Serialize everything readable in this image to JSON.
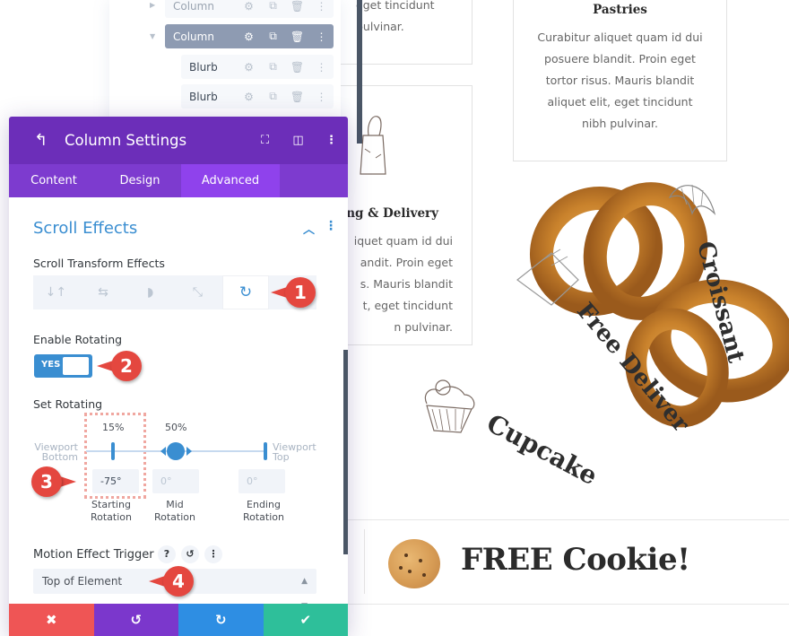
{
  "layers": {
    "rows": [
      {
        "label": "Column",
        "expanded": false,
        "selected": false
      },
      {
        "label": "Column",
        "expanded": true,
        "selected": true
      },
      {
        "label": "Blurb",
        "selected": false
      },
      {
        "label": "Blurb",
        "selected": false
      }
    ],
    "row_icons": [
      "gear-icon",
      "duplicate-icon",
      "trash-icon",
      "more-icon"
    ]
  },
  "page": {
    "card_left_top": {
      "lines": [
        "eget tincidunt",
        "pulvinar."
      ]
    },
    "card_left_mid": {
      "title": "ng & Delivery",
      "lines": [
        "iquet quam id dui",
        "andit. Proin eget",
        "s. Mauris blandit",
        "t, eget tincidunt",
        "n pulvinar."
      ]
    },
    "card_right_top": {
      "title": "Pastries",
      "lines": [
        "Curabitur aliquet quam id dui",
        "posuere blandit. Proin eget",
        "tortor risus. Mauris blandit",
        "aliquet elit, eget tincidunt",
        "nibh pulvinar."
      ]
    },
    "rotated_labels": {
      "croissant": "Croissant",
      "free_delivery": "Free Deliver",
      "cupcake": "Cupcake"
    },
    "promo": {
      "text": "FREE Cookie!"
    }
  },
  "modal": {
    "title": "Column Settings",
    "header_icons": [
      "back-icon",
      "fullscreen-icon",
      "split-view-icon",
      "more-icon"
    ],
    "tabs": [
      {
        "label": "Content",
        "active": false
      },
      {
        "label": "Design",
        "active": false
      },
      {
        "label": "Advanced",
        "active": true
      }
    ],
    "section": {
      "title": "Scroll Effects",
      "expanded": true
    },
    "scroll_transform": {
      "label": "Scroll Transform Effects",
      "effects": [
        {
          "name": "vertical-motion",
          "glyph": "↓↑",
          "active": false
        },
        {
          "name": "horizontal-motion",
          "glyph": "⇆",
          "active": false
        },
        {
          "name": "fading",
          "glyph": "◗",
          "active": false
        },
        {
          "name": "scaling",
          "glyph": "⤡",
          "active": false
        },
        {
          "name": "rotating",
          "glyph": "↻",
          "active": true
        }
      ]
    },
    "enable_rotating": {
      "label": "Enable Rotating",
      "value": "YES",
      "on": true
    },
    "set_rotating": {
      "label": "Set Rotating",
      "start_percent": "15%",
      "mid_percent": "50%",
      "start_value": 0.15,
      "mid_value": 0.5,
      "end_value": 1.0,
      "viewport_bottom": [
        "Viewport",
        "Bottom"
      ],
      "viewport_top": [
        "Viewport",
        "Top"
      ],
      "starting_rotation": {
        "value": "-75°",
        "caption": [
          "Starting",
          "Rotation"
        ]
      },
      "mid_rotation": {
        "placeholder": "0°",
        "caption": [
          "Mid",
          "Rotation"
        ]
      },
      "ending_rotation": {
        "placeholder": "0°",
        "caption": [
          "Ending",
          "Rotation"
        ]
      }
    },
    "motion_trigger": {
      "label": "Motion Effect Trigger",
      "help": "?",
      "reset": "↺",
      "more": "⋮",
      "selected": "Top of Element"
    },
    "footer": {
      "cancel": "✖",
      "undo": "↺",
      "redo": "↻",
      "save": "✔"
    }
  },
  "callouts": [
    "1",
    "2",
    "3",
    "4"
  ],
  "colors": {
    "purple_dark": "#6c2eb9",
    "purple_tab": "#7d3bcf",
    "accent_blue": "#3a8ed1",
    "cancel_red": "#ef5555",
    "save_green": "#2ebf9a",
    "callout_red": "#e4473f"
  }
}
